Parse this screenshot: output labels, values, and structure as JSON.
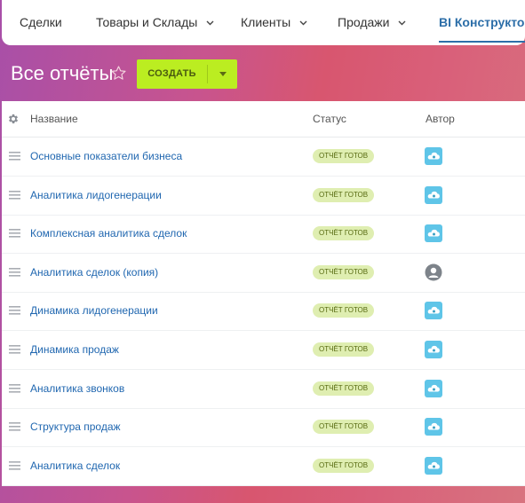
{
  "nav": {
    "items": [
      {
        "label": "Сделки",
        "has_chevron": false,
        "active": false
      },
      {
        "label": "Товары и Склады",
        "has_chevron": true,
        "active": false
      },
      {
        "label": "Клиенты",
        "has_chevron": true,
        "active": false
      },
      {
        "label": "Продажи",
        "has_chevron": true,
        "active": false
      },
      {
        "label": "BI Конструктор",
        "has_chevron": false,
        "active": true
      }
    ]
  },
  "header": {
    "title": "Все отчёты",
    "create_label": "СОЗДАТЬ"
  },
  "table": {
    "columns": {
      "name": "Название",
      "status": "Статус",
      "author": "Автор"
    },
    "rows": [
      {
        "name": "Основные показатели бизнеса",
        "status": "ОТЧЁТ ГОТОВ",
        "author_icon": "cloud-avatar-icon"
      },
      {
        "name": "Аналитика лидогенерации",
        "status": "ОТЧЁТ ГОТОВ",
        "author_icon": "cloud-avatar-icon"
      },
      {
        "name": "Комплексная аналитика сделок",
        "status": "ОТЧЁТ ГОТОВ",
        "author_icon": "cloud-avatar-icon"
      },
      {
        "name": "Аналитика сделок (копия)",
        "status": "ОТЧЁТ ГОТОВ",
        "author_icon": "user-avatar-icon"
      },
      {
        "name": "Динамика лидогенерации",
        "status": "ОТЧЁТ ГОТОВ",
        "author_icon": "cloud-avatar-icon"
      },
      {
        "name": "Динамика продаж",
        "status": "ОТЧЁТ ГОТОВ",
        "author_icon": "cloud-avatar-icon"
      },
      {
        "name": "Аналитика звонков",
        "status": "ОТЧЁТ ГОТОВ",
        "author_icon": "cloud-avatar-icon"
      },
      {
        "name": "Структура продаж",
        "status": "ОТЧЁТ ГОТОВ",
        "author_icon": "cloud-avatar-icon"
      },
      {
        "name": "Аналитика сделок",
        "status": "ОТЧЁТ ГОТОВ",
        "author_icon": "cloud-avatar-icon"
      }
    ]
  },
  "colors": {
    "accent": "#2c6ea8",
    "create_button": "#bbed21",
    "status_badge": "#dfeeb1"
  }
}
